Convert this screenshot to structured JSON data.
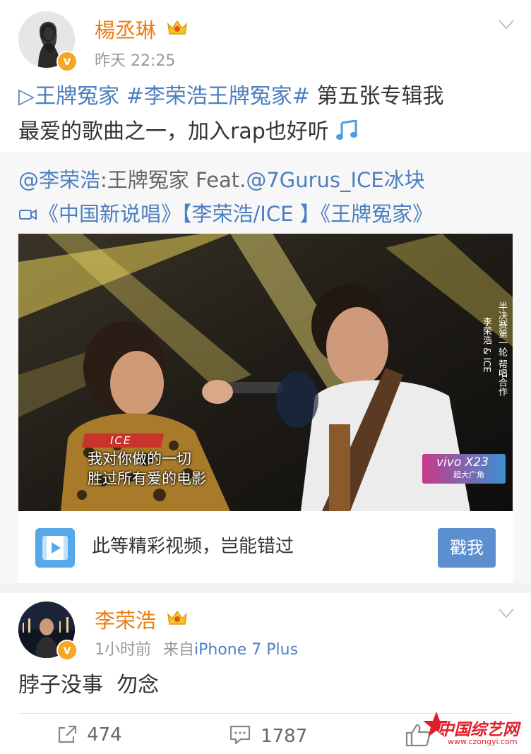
{
  "post1": {
    "user_name": "楊丞琳",
    "time": "昨天 22:25",
    "text_link1": "▷王牌冤家",
    "text_link2": "#李荣浩王牌冤家#",
    "text_rest_line1": " 第五张专辑我",
    "text_line2": "最爱的歌曲之一，加入rap也好听",
    "repost": {
      "line1_mention1": "@李荣浩",
      "line1_colon": ":王牌冤家 Feat.",
      "line1_mention2": "@7Gurus_ICE冰块",
      "line2_video_title": "《中国新说唱》【李荣浩/ICE 】《王牌冤家》",
      "video": {
        "caption_tag": "ICE",
        "subtitle_line1": "我对你做的一切",
        "subtitle_line2": "胜过所有爱的电影",
        "side_label": "半决赛第一轮 帮唱合作",
        "side_names": "李荣浩 & ICE",
        "sponsor": "vivo X23",
        "sponsor_sub": "超大广角"
      },
      "card": {
        "text": "此等精彩视频，岂能错过",
        "button": "戳我"
      }
    }
  },
  "post2": {
    "user_name": "李荣浩",
    "time": "1小时前",
    "source_prefix": "来自",
    "source": "iPhone 7 Plus",
    "text": "脖子没事  勿念",
    "actions": {
      "repost_count": "474",
      "comment_count": "1787"
    }
  },
  "watermark": {
    "title": "中国综艺网",
    "url": "www.czongyi.com"
  },
  "colors": {
    "link": "#4d7fbf",
    "username": "#ea7c14",
    "button": "#5b8fd0"
  }
}
